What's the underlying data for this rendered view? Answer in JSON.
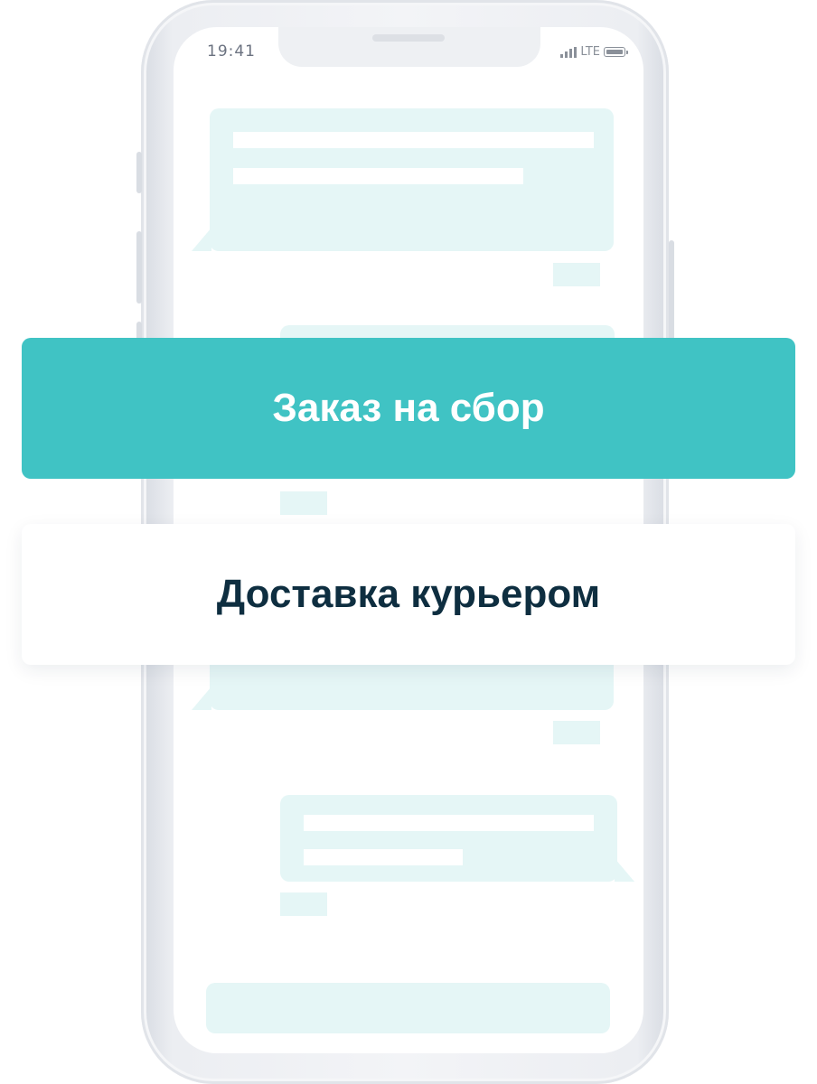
{
  "status_bar": {
    "time": "19:41",
    "network": "LTE",
    "signal_icon": "signal-bars-icon",
    "battery_icon": "battery-icon"
  },
  "options": {
    "pickup_label": "Заказ на сбор",
    "courier_label": "Доставка курьером"
  },
  "colors": {
    "accent": "#40c3c4",
    "bubble": "#e5f6f6",
    "dark_text": "#0e2e40"
  }
}
